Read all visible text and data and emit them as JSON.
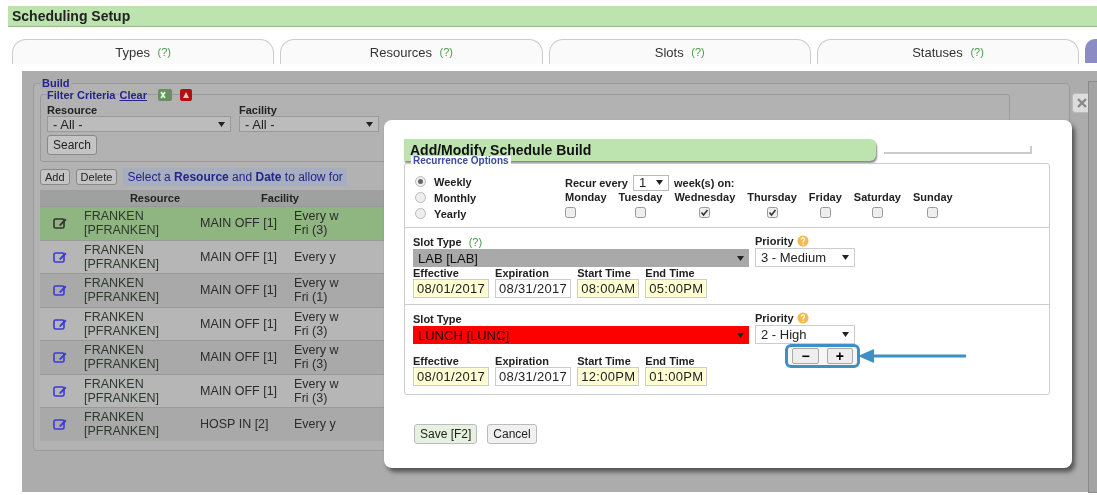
{
  "header": {
    "title": "Scheduling Setup"
  },
  "tabs": [
    {
      "label": "Types",
      "help": "(?)",
      "selected": false
    },
    {
      "label": "Resources",
      "help": "(?)",
      "selected": false
    },
    {
      "label": "Slots",
      "help": "(?)",
      "selected": false
    },
    {
      "label": "Statuses",
      "help": "(?)",
      "selected": false
    }
  ],
  "build": {
    "legend": "Build",
    "filter": {
      "legend": "Filter Criteria",
      "clear": "Clear",
      "fields": [
        {
          "label": "Resource",
          "value": "- All -"
        },
        {
          "label": "Facility",
          "value": "- All -"
        }
      ],
      "search": "Search"
    },
    "buttons": [
      "Add",
      "Delete"
    ],
    "hint": "Select a **Resource** and **Date** to allow for",
    "table": {
      "columns": [
        "Resource",
        "Facility"
      ],
      "rows": [
        {
          "selected": true,
          "resource": "FRANKEN [PFRANKEN]",
          "facility": "MAIN OFF [1]",
          "column_3": [
            "Every w",
            "Fri (3)"
          ]
        },
        {
          "selected": false,
          "resource": "FRANKEN [PFRANKEN]",
          "facility": "MAIN OFF [1]",
          "column_3": [
            "Every y"
          ]
        },
        {
          "selected": false,
          "resource": "FRANKEN [PFRANKEN]",
          "facility": "MAIN OFF [1]",
          "column_3": [
            "Every w",
            "Fri (1)"
          ]
        },
        {
          "selected": false,
          "resource": "FRANKEN [PFRANKEN]",
          "facility": "MAIN OFF [1]",
          "column_3": [
            "Every w",
            "Fri (3)"
          ]
        },
        {
          "selected": false,
          "resource": "FRANKEN [PFRANKEN]",
          "facility": "MAIN OFF [1]",
          "column_3": [
            "Every w",
            "Fri (3)"
          ]
        },
        {
          "selected": false,
          "resource": "FRANKEN [PFRANKEN]",
          "facility": "MAIN OFF [1]",
          "column_3": [
            "Every w",
            "Fri (3)"
          ]
        },
        {
          "selected": false,
          "resource": "FRANKEN [PFRANKEN]",
          "facility": "HOSP IN [2]",
          "column_3": [
            "Every y"
          ]
        }
      ]
    }
  },
  "modal": {
    "title": "Add/Modify Schedule Build",
    "legend": "Recurrence Options",
    "recurrence": [
      {
        "label": "Weekly",
        "selected": true
      },
      {
        "label": "Monthly",
        "selected": false
      },
      {
        "label": "Yearly",
        "selected": false
      }
    ],
    "recur_every": {
      "label": "Recur every",
      "value": "1",
      "suffix": "week(s) on:"
    },
    "days": [
      {
        "label": "Monday",
        "checked": false
      },
      {
        "label": "Tuesday",
        "checked": false
      },
      {
        "label": "Wednesday",
        "checked": true
      },
      {
        "label": "Thursday",
        "checked": true
      },
      {
        "label": "Friday",
        "checked": false
      },
      {
        "label": "Saturday",
        "checked": false
      },
      {
        "label": "Sunday",
        "checked": false
      }
    ],
    "slots": [
      {
        "slot_label": "Slot Type",
        "slot_help": "(?)",
        "slot_type": "LAB [LAB]",
        "color": "#a9a9a9",
        "priority_label": "Priority",
        "priority": "3 - Medium",
        "effective_label": "Effective",
        "effective": "08/01/2017",
        "expiration_label": "Expiration",
        "expiration": "08/31/2017",
        "start_label": "Start Time",
        "start": "08:00AM",
        "end_label": "End Time",
        "end": "05:00PM"
      },
      {
        "slot_label": "Slot Type",
        "slot_type": "LUNCH [LUNC]",
        "color": "#ff0000",
        "priority_label": "Priority",
        "priority": "2 - High",
        "effective_label": "Effective",
        "effective": "08/01/2017",
        "expiration_label": "Expiration",
        "expiration": "08/31/2017",
        "start_label": "Start Time",
        "start": "12:00PM",
        "end_label": "End Time",
        "end": "01:00PM",
        "controls": [
          "−",
          "+"
        ]
      }
    ],
    "buttons": [
      {
        "label": "Save [F2]",
        "kind": "primary"
      },
      {
        "label": "Cancel",
        "kind": "plain"
      }
    ]
  }
}
